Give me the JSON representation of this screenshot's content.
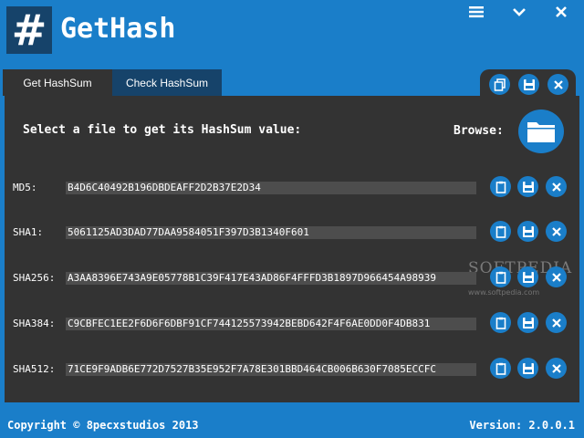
{
  "app": {
    "title": "GetHash",
    "logo_symbol": "#"
  },
  "window_controls": {
    "menu": "menu-icon",
    "minimize": "chevron-down-icon",
    "close": "close-icon"
  },
  "tabs": [
    {
      "label": "Get HashSum",
      "active": true
    },
    {
      "label": "Check HashSum",
      "active": false
    }
  ],
  "main": {
    "prompt": "Select a file to get its HashSum value:",
    "browse_label": "Browse:"
  },
  "hashes": [
    {
      "label": "MD5:",
      "value": "B4D6C40492B196DBDEAFF2D2B37E2D34"
    },
    {
      "label": "SHA1:",
      "value": "5061125AD3DAD77DAA9584051F397D3B1340F601"
    },
    {
      "label": "SHA256:",
      "value": "A3AA8396E743A9E05778B1C39F417E43AD86F4FFFD3B1897D966454A98939"
    },
    {
      "label": "SHA384:",
      "value": "C9CBFEC1EE2F6D6F6DBF91CF744125573942BEBD642F4F6AE0DD0F4DB831"
    },
    {
      "label": "SHA512:",
      "value": "71CE9F9ADB6E772D7527B35E952F7A78E301BBD464CB006B630F7085ECCFC"
    }
  ],
  "footer": {
    "copyright": "Copyright © 8pecxstudios 2013",
    "version": "Version: 2.0.0.1"
  },
  "watermark": {
    "text": "SOFTPEDIA",
    "url": "www.softpedia.com"
  },
  "colors": {
    "accent": "#1a7ec9",
    "panel": "#333333",
    "tab_inactive": "#16436a",
    "field": "#4d4d4d"
  }
}
